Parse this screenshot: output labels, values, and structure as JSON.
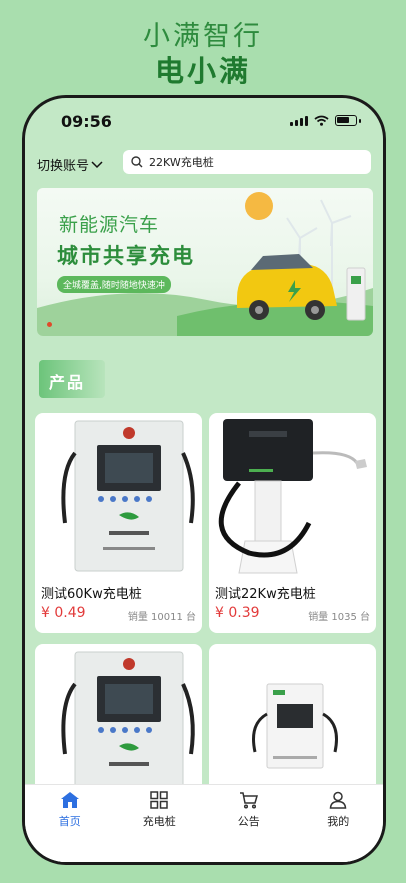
{
  "promo": {
    "title": "小满智行",
    "subtitle": "电小满"
  },
  "status_bar": {
    "time": "09:56"
  },
  "header": {
    "account_label": "切换账号",
    "search_value": "22KW充电桩"
  },
  "banner": {
    "line1": "新能源汽车",
    "line2": "城市共享充电",
    "tag": "全城覆盖,随时随地快速冲"
  },
  "section": {
    "title": "产品"
  },
  "products": [
    {
      "name": "测试60Kw充电桩",
      "price": "¥ 0.49",
      "sales": "销量 10011 台"
    },
    {
      "name": "测试22Kw充电桩",
      "price": "¥ 0.39",
      "sales": "销量 1035 台"
    },
    {
      "name": "",
      "price": "",
      "sales": ""
    },
    {
      "name": "",
      "price": "",
      "sales": ""
    }
  ],
  "tabs": [
    {
      "label": "首页",
      "icon": "home-icon"
    },
    {
      "label": "充电桩",
      "icon": "grid-icon"
    },
    {
      "label": "公告",
      "icon": "cart-icon"
    },
    {
      "label": "我的",
      "icon": "user-icon"
    }
  ],
  "colors": {
    "accent": "#2d6fe0",
    "price": "#e23a3a",
    "brand_green": "#2e8b3e"
  }
}
